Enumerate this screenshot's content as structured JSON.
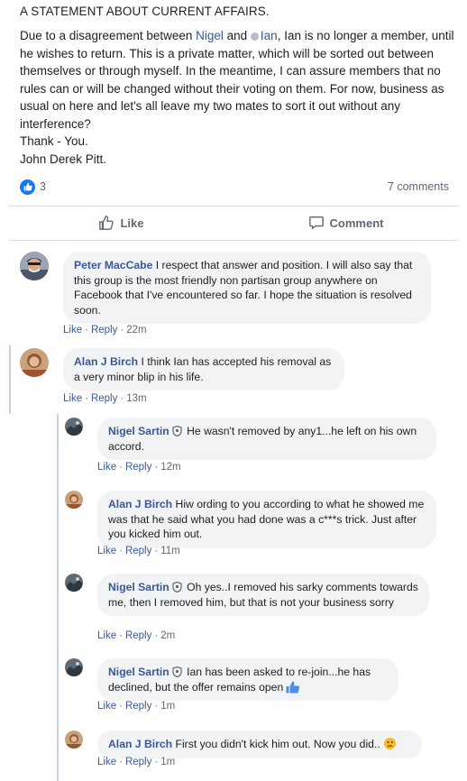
{
  "post": {
    "title": "A STATEMENT ABOUT CURRENT AFFAIRS.",
    "body_1": "Due to a disagreement between ",
    "tag_1": "Nigel",
    "body_2": " and ",
    "tag_2": "Ian",
    "body_3": ", Ian is no longer a member, until he wishes to return. This is a private matter, which will be sorted out between themselves or through myself. In the meantime, I can assure members that no rules can or will be changed without their voting on them. For now, business as usual on here and let's all leave my two mates to sort it out without any interference?",
    "line_thanks": "Thank - You.",
    "line_signature": "John Derek Pitt.",
    "likes_count": "3",
    "comments_count": "7 comments",
    "like_label": "Like",
    "comment_label": "Comment"
  },
  "comments": [
    {
      "author": "Peter MacCabe",
      "text": "I respect that answer and position. I will also say that this group is the most friendly non partisan group anywhere on Facebook that I've encountered so far. I hope the situation is resolved soon.",
      "like": "Like",
      "reply": "Reply",
      "time": "22m"
    },
    {
      "author": "Alan J Birch",
      "text": "I think Ian has accepted his removal as a very minor blip in his life.",
      "like": "Like",
      "reply": "Reply",
      "time": "13m"
    }
  ],
  "replies": [
    {
      "author": "Nigel Sartin",
      "admin": true,
      "text": "He wasn't removed by any1...he left on his own accord.",
      "like": "Like",
      "reply": "Reply",
      "time": "12m"
    },
    {
      "author": "Alan J Birch",
      "admin": false,
      "text": "Hiw ording to you according to what he showed me was that he said what you had done was a c***s trick. Just after you kicked him out.",
      "like": "Like",
      "reply": "Reply",
      "time": "11m"
    },
    {
      "author": "Nigel Sartin",
      "admin": true,
      "text": "Oh yes..I removed his sarky comments towards me, then I removed him, but that is not your business sorry",
      "like": "Like",
      "reply": "Reply",
      "time": "2m"
    },
    {
      "author": "Nigel Sartin",
      "admin": true,
      "text": "Ian has been asked to re-join...he has declined, but the offer remains open",
      "like": "Like",
      "reply": "Reply",
      "time": "1m"
    },
    {
      "author": "Alan J Birch",
      "admin": false,
      "text": "First you didn't kick him out. Now you did..",
      "like": "Like",
      "reply": "Reply",
      "time": "1m"
    }
  ],
  "colors": {
    "link": "#385898",
    "meta": "#606770",
    "bubble": "#f2f3f5",
    "accent": "#1877f2"
  }
}
